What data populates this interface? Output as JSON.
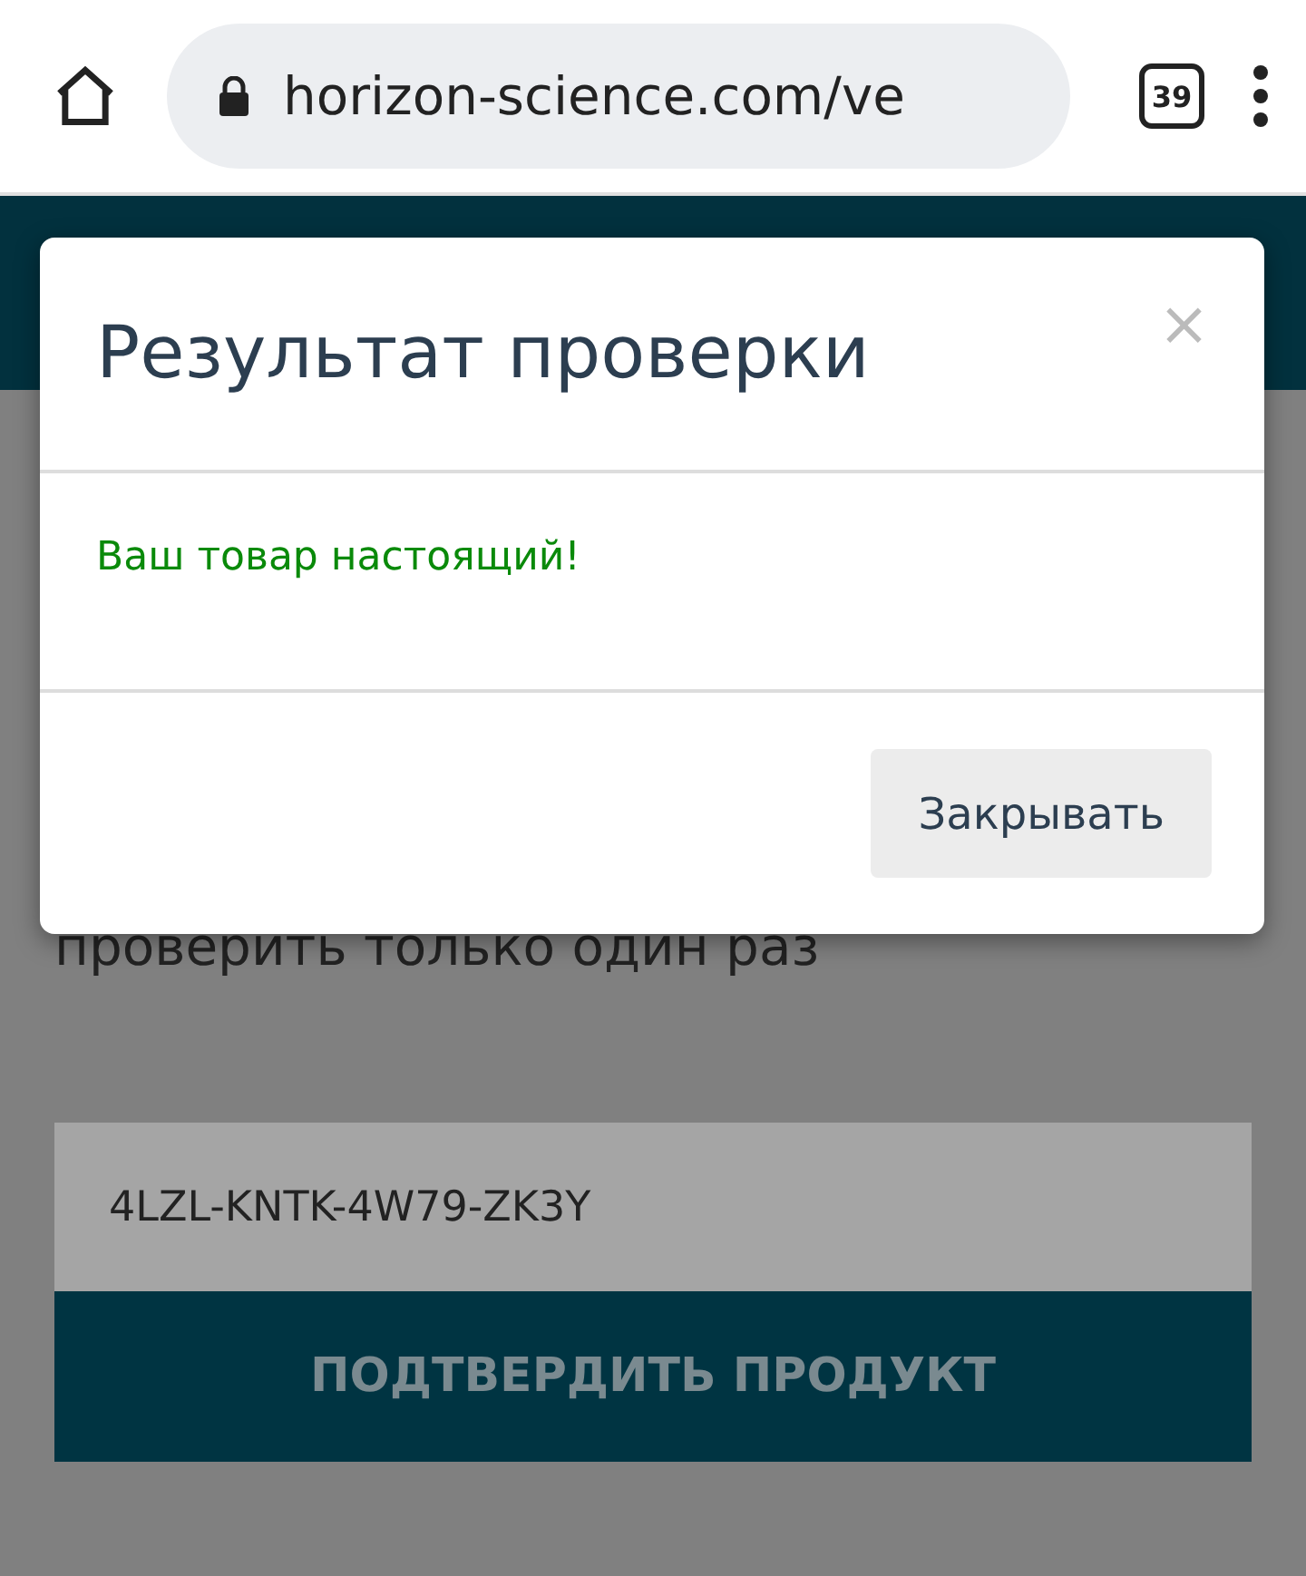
{
  "browser": {
    "url": "horizon-science.com/ve",
    "tab_count": "39"
  },
  "page": {
    "instruction": "проверить только один раз",
    "code_field": {
      "value": "4LZL-KNTK-4W79-ZK3Y"
    },
    "submit_button": "ПОДТВЕРДИТЬ ПРОДУКТ"
  },
  "modal": {
    "title": "Результат проверки",
    "close": "×",
    "message": "Ваш товар настоящий!",
    "buttons": [
      "Закрывать"
    ]
  }
}
